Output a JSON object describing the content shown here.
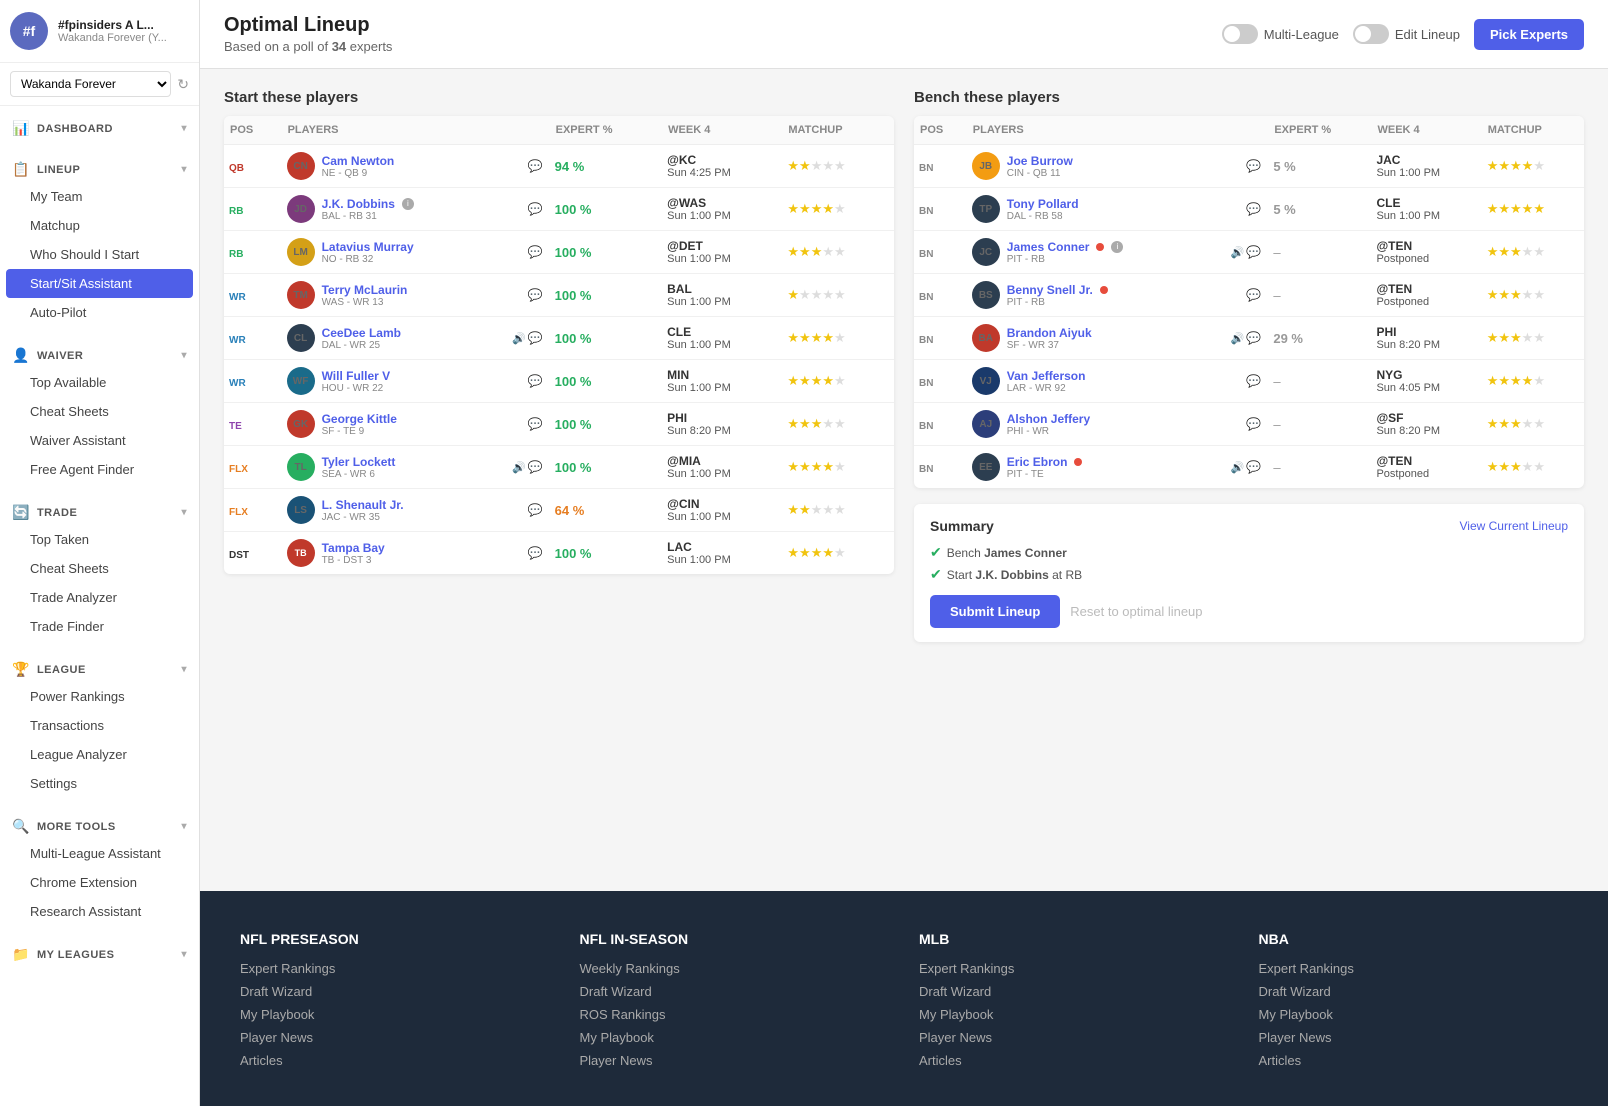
{
  "sidebar": {
    "header": {
      "initials": "#f",
      "title": "#fpinsiders A L...",
      "subtitle": "Wakanda Forever (Y..."
    },
    "league_selector": {
      "value": "Wakanda Forever",
      "options": [
        "Wakanda Forever"
      ]
    },
    "sections": [
      {
        "id": "dashboard",
        "icon": "📊",
        "label": "DASHBOARD",
        "items": []
      },
      {
        "id": "lineup",
        "icon": "📋",
        "label": "LINEUP",
        "items": [
          "My Team",
          "Matchup",
          "Who Should I Start",
          "Start/Sit Assistant",
          "Auto-Pilot"
        ]
      },
      {
        "id": "waiver",
        "icon": "👤",
        "label": "WAIVER",
        "items": [
          "Top Available",
          "Cheat Sheets",
          "Waiver Assistant",
          "Free Agent Finder"
        ]
      },
      {
        "id": "trade",
        "icon": "🔄",
        "label": "TRADE",
        "items": [
          "Top Taken",
          "Cheat Sheets",
          "Trade Analyzer",
          "Trade Finder"
        ]
      },
      {
        "id": "league",
        "icon": "🏆",
        "label": "LEAGUE",
        "items": [
          "Power Rankings",
          "Transactions",
          "League Analyzer",
          "Settings"
        ]
      },
      {
        "id": "more_tools",
        "icon": "🔍",
        "label": "MORE TOOLS",
        "items": [
          "Multi-League Assistant",
          "Chrome Extension",
          "Research Assistant"
        ]
      },
      {
        "id": "my_leagues",
        "icon": "📁",
        "label": "MY LEAGUES",
        "items": []
      }
    ],
    "active_item": "Start/Sit Assistant"
  },
  "topbar": {
    "title": "Optimal Lineup",
    "subtitle": "Based on a poll of",
    "expert_count": "34",
    "subtitle_suffix": "experts",
    "multi_league_label": "Multi-League",
    "edit_lineup_label": "Edit Lineup",
    "pick_experts_label": "Pick Experts"
  },
  "start_section": {
    "title": "Start these players",
    "columns": [
      "POS",
      "PLAYERS",
      "EXPERT %",
      "WEEK 4",
      "MATCHUP"
    ],
    "rows": [
      {
        "pos": "QB",
        "pos_class": "pos-qb",
        "name": "Cam Newton",
        "meta": "NE - QB 9",
        "pct": "94 %",
        "pct_class": "pct-green",
        "matchup": "@KC",
        "matchup_time": "Sun 4:25 PM",
        "stars": 2,
        "max_stars": 5,
        "avatar_color": "#c0392b",
        "avatar_initials": "CN",
        "has_chat": true
      },
      {
        "pos": "RB",
        "pos_class": "pos-rb",
        "name": "J.K. Dobbins",
        "meta": "BAL - RB 31",
        "pct": "100 %",
        "pct_class": "pct-green",
        "matchup": "@WAS",
        "matchup_time": "Sun 1:00 PM",
        "stars": 4,
        "max_stars": 5,
        "avatar_color": "#7c3a7c",
        "avatar_initials": "JD",
        "has_chat": true,
        "has_info": true
      },
      {
        "pos": "RB",
        "pos_class": "pos-rb",
        "name": "Latavius Murray",
        "meta": "NO - RB 32",
        "pct": "100 %",
        "pct_class": "pct-green",
        "matchup": "@DET",
        "matchup_time": "Sun 1:00 PM",
        "stars": 3,
        "max_stars": 5,
        "avatar_color": "#d4a017",
        "avatar_initials": "LM",
        "has_chat": true
      },
      {
        "pos": "WR",
        "pos_class": "pos-wr",
        "name": "Terry McLaurin",
        "meta": "WAS - WR 13",
        "pct": "100 %",
        "pct_class": "pct-green",
        "matchup": "BAL",
        "matchup_time": "Sun 1:00 PM",
        "stars": 1,
        "max_stars": 5,
        "avatar_color": "#c0392b",
        "avatar_initials": "TM",
        "has_chat": true
      },
      {
        "pos": "WR",
        "pos_class": "pos-wr",
        "name": "CeeDee Lamb",
        "meta": "DAL - WR 25",
        "pct": "100 %",
        "pct_class": "pct-green",
        "matchup": "CLE",
        "matchup_time": "Sun 1:00 PM",
        "stars": 4,
        "max_stars": 5,
        "avatar_color": "#2c3e50",
        "avatar_initials": "CL",
        "has_chat": true,
        "has_sound": true
      },
      {
        "pos": "WR",
        "pos_class": "pos-wr",
        "name": "Will Fuller V",
        "meta": "HOU - WR 22",
        "pct": "100 %",
        "pct_class": "pct-green",
        "matchup": "MIN",
        "matchup_time": "Sun 1:00 PM",
        "stars": 4,
        "max_stars": 5,
        "avatar_color": "#1a6b8a",
        "avatar_initials": "WF",
        "has_chat": true
      },
      {
        "pos": "TE",
        "pos_class": "pos-te",
        "name": "George Kittle",
        "meta": "SF - TE 9",
        "pct": "100 %",
        "pct_class": "pct-green",
        "matchup": "PHI",
        "matchup_time": "Sun 8:20 PM",
        "stars": 3,
        "max_stars": 5,
        "avatar_color": "#c0392b",
        "avatar_initials": "GK",
        "has_chat": true
      },
      {
        "pos": "FLX",
        "pos_class": "pos-flx",
        "name": "Tyler Lockett",
        "meta": "SEA - WR 6",
        "pct": "100 %",
        "pct_class": "pct-green",
        "matchup": "@MIA",
        "matchup_time": "Sun 1:00 PM",
        "stars": 4,
        "max_stars": 5,
        "avatar_color": "#27ae60",
        "avatar_initials": "TL",
        "has_chat": true,
        "has_sound": true
      },
      {
        "pos": "FLX",
        "pos_class": "pos-flx",
        "name": "L. Shenault Jr.",
        "meta": "JAC - WR 35",
        "pct": "64 %",
        "pct_class": "pct-orange",
        "matchup": "@CIN",
        "matchup_time": "Sun 1:00 PM",
        "stars": 2,
        "max_stars": 5,
        "avatar_color": "#1a5276",
        "avatar_initials": "LS",
        "has_chat": true
      },
      {
        "pos": "DST",
        "pos_class": "pos-dst",
        "name": "Tampa Bay",
        "meta": "TB - DST 3",
        "pct": "100 %",
        "pct_class": "pct-green",
        "matchup": "LAC",
        "matchup_time": "Sun 1:00 PM",
        "stars": 4,
        "max_stars": 5,
        "is_dst": true,
        "has_chat": true
      }
    ]
  },
  "bench_section": {
    "title": "Bench these players",
    "columns": [
      "POS",
      "PLAYERS",
      "EXPERT %",
      "WEEK 4",
      "MATCHUP"
    ],
    "rows": [
      {
        "pos": "BN",
        "name": "Joe Burrow",
        "meta": "CIN - QB 11",
        "pct": "5 %",
        "pct_class": "pct-gray",
        "matchup": "JAC",
        "matchup_time": "Sun 1:00 PM",
        "stars": 4,
        "max_stars": 5,
        "avatar_color": "#f39c12",
        "avatar_initials": "JB",
        "has_chat": true
      },
      {
        "pos": "BN",
        "name": "Tony Pollard",
        "meta": "DAL - RB 58",
        "pct": "5 %",
        "pct_class": "pct-gray",
        "matchup": "CLE",
        "matchup_time": "Sun 1:00 PM",
        "stars": 5,
        "max_stars": 5,
        "avatar_color": "#2c3e50",
        "avatar_initials": "TP",
        "has_chat": true
      },
      {
        "pos": "BN",
        "name": "James Conner",
        "meta": "PIT - RB",
        "pct": "-",
        "pct_class": "dash-cell",
        "matchup": "@TEN",
        "matchup_time": "Postponed",
        "stars": 3,
        "max_stars": 5,
        "avatar_color": "#2c3e50",
        "avatar_initials": "JC",
        "has_chat": true,
        "has_sound": true,
        "has_dot": true,
        "has_info": true
      },
      {
        "pos": "BN",
        "name": "Benny Snell Jr.",
        "meta": "PIT - RB",
        "pct": "-",
        "pct_class": "dash-cell",
        "matchup": "@TEN",
        "matchup_time": "Postponed",
        "stars": 3,
        "max_stars": 5,
        "avatar_color": "#2c3e50",
        "avatar_initials": "BS",
        "has_chat": true,
        "has_dot": true
      },
      {
        "pos": "BN",
        "name": "Brandon Aiyuk",
        "meta": "SF - WR 37",
        "pct": "29 %",
        "pct_class": "pct-gray",
        "matchup": "PHI",
        "matchup_time": "Sun 8:20 PM",
        "stars": 3,
        "max_stars": 5,
        "avatar_color": "#c0392b",
        "avatar_initials": "BA",
        "has_chat": true,
        "has_sound": true
      },
      {
        "pos": "BN",
        "name": "Van Jefferson",
        "meta": "LAR - WR 92",
        "pct": "-",
        "pct_class": "dash-cell",
        "matchup": "NYG",
        "matchup_time": "Sun 4:05 PM",
        "stars": 4,
        "max_stars": 5,
        "avatar_color": "#1a3a6b",
        "avatar_initials": "VJ",
        "has_chat": true
      },
      {
        "pos": "BN",
        "name": "Alshon Jeffery",
        "meta": "PHI - WR",
        "pct": "-",
        "pct_class": "dash-cell",
        "matchup": "@SF",
        "matchup_time": "Sun 8:20 PM",
        "stars": 3,
        "max_stars": 5,
        "avatar_color": "#2c3e7a",
        "avatar_initials": "AJ",
        "has_chat": true
      },
      {
        "pos": "BN",
        "name": "Eric Ebron",
        "meta": "PIT - TE",
        "pct": "-",
        "pct_class": "dash-cell",
        "matchup": "@TEN",
        "matchup_time": "Postponed",
        "stars": 3,
        "max_stars": 5,
        "avatar_color": "#2c3e50",
        "avatar_initials": "EE",
        "has_chat": true,
        "has_sound": true,
        "has_dot": true
      }
    ]
  },
  "summary": {
    "title": "Summary",
    "view_link": "View Current Lineup",
    "items": [
      {
        "text": "Bench James Conner",
        "bold": "James Conner"
      },
      {
        "text": "Start J.K. Dobbins at RB",
        "bold": "J.K. Dobbins"
      }
    ],
    "submit_label": "Submit Lineup",
    "reset_label": "Reset to optimal lineup"
  },
  "footer": {
    "columns": [
      {
        "title": "NFL PRESEASON",
        "links": [
          "Expert Rankings",
          "Draft Wizard",
          "My Playbook",
          "Player News",
          "Articles"
        ]
      },
      {
        "title": "NFL IN-SEASON",
        "links": [
          "Weekly Rankings",
          "Draft Wizard",
          "ROS Rankings",
          "My Playbook",
          "Player News"
        ]
      },
      {
        "title": "MLB",
        "links": [
          "Expert Rankings",
          "Draft Wizard",
          "My Playbook",
          "Player News",
          "Articles"
        ]
      },
      {
        "title": "NBA",
        "links": [
          "Expert Rankings",
          "Draft Wizard",
          "My Playbook",
          "Player News",
          "Articles"
        ]
      }
    ]
  }
}
